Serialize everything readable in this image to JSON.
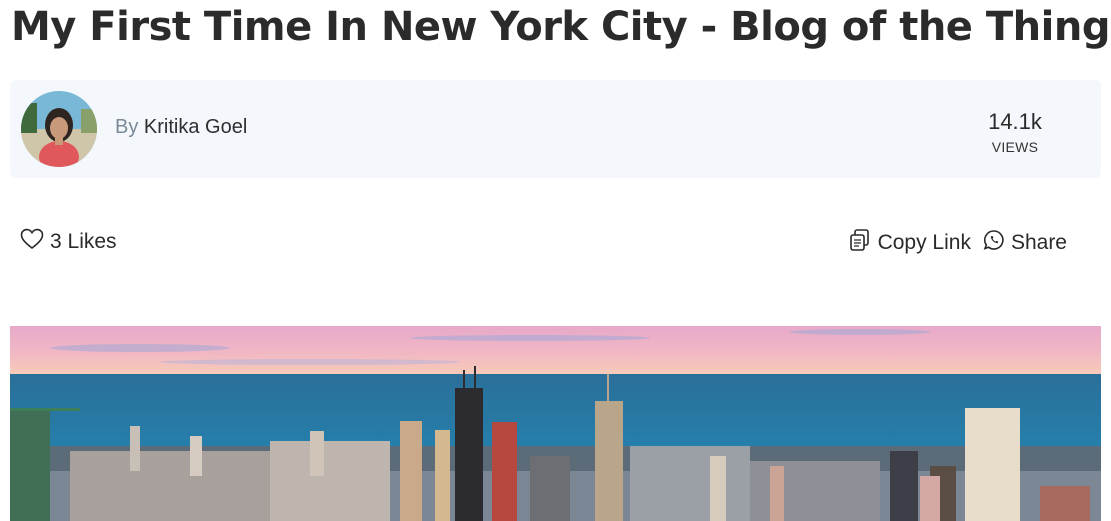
{
  "page": {
    "title": "My First Time In New York City - Blog of the Things"
  },
  "author": {
    "by_label": "By",
    "name": "Kritika Goel"
  },
  "stats": {
    "views_count": "14.1k",
    "views_label": "VIEWS"
  },
  "actions": {
    "likes_label": "3 Likes",
    "copy_link_label": "Copy Link",
    "share_label": "Share"
  },
  "icons": {
    "likes": "heart-outline-icon",
    "copy_link": "copy-icon",
    "share": "whatsapp-icon"
  },
  "colors": {
    "card_background": "#f4f8fc",
    "byline_muted": "#7b8a98",
    "text": "#2a2a2a"
  }
}
